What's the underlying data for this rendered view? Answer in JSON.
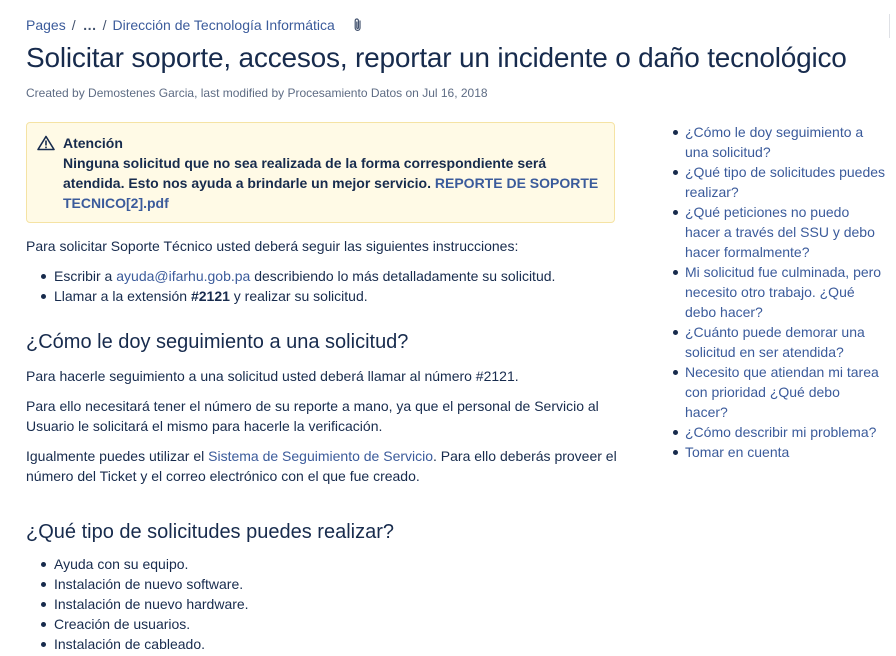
{
  "breadcrumb": {
    "pages": "Pages",
    "sep1": "/",
    "ellipsis": "…",
    "sep2": "/",
    "parent": "Dirección de Tecnología Informática"
  },
  "title": "Solicitar soporte, accesos, reportar un incidente o daño tecnológico",
  "byline": "Created by Demostenes Garcia, last modified by Procesamiento Datos on Jul 16, 2018",
  "warning": {
    "title": "Atención",
    "text": "Ninguna solicitud que no sea realizada de la forma correspondiente será atendida. Esto nos ayuda a brindarle un mejor servicio.",
    "link": "REPORTE DE SOPORTE TECNICO[2].pdf"
  },
  "intro": "Para solicitar Soporte Técnico usted deberá seguir las siguientes instrucciones:",
  "instructions": {
    "email_prefix": "Escribir a",
    "email": "ayuda@ifarhu.gob.pa",
    "email_suffix": "describiendo lo más detalladamente su solicitud.",
    "ext_prefix": "Llamar a la extensión",
    "ext": "#2121",
    "ext_suffix": "y realizar su solicitud."
  },
  "section1": {
    "heading": "¿Cómo le doy seguimiento a una solicitud?",
    "p1": "Para hacerle seguimiento a una solicitud usted deberá llamar al número #2121.",
    "p2": "Para ello necesitará tener el número de su reporte a mano, ya que el personal de Servicio al Usuario le solicitará el mismo para hacerle la verificación.",
    "p3_prefix": "Igualmente puedes utilizar el",
    "p3_link": "Sistema de Seguimiento de Servicio",
    "p3_suffix": ". Para ello deberás proveer el número del Ticket y el correo electrónico con el que fue creado."
  },
  "section2": {
    "heading": "¿Qué tipo de solicitudes puedes realizar?",
    "items": [
      "Ayuda con su equipo.",
      "Instalación de nuevo software.",
      "Instalación de nuevo hardware.",
      "Creación de usuarios.",
      "Instalación de cableado."
    ]
  },
  "toc": [
    "¿Cómo le doy seguimiento a una solicitud?",
    "¿Qué tipo de solicitudes puedes realizar?",
    "¿Qué peticiones no puedo hacer a través del SSU y debo hacer formalmente?",
    "Mi solicitud fue culminada, pero necesito otro trabajo. ¿Qué debo hacer?",
    "¿Cuánto puede demorar una solicitud en ser atendida?",
    "Necesito que atiendan mi tarea con prioridad ¿Qué debo hacer?",
    "¿Cómo describir mi problema?",
    "Tomar en cuenta"
  ],
  "icons": {
    "attachment": "paperclip-icon",
    "warning": "warning-triangle-icon"
  },
  "colors": {
    "link": "#3b5b9b",
    "text": "#172b4d",
    "warning_bg": "#fffae6",
    "warning_border": "#f5e3a4"
  }
}
